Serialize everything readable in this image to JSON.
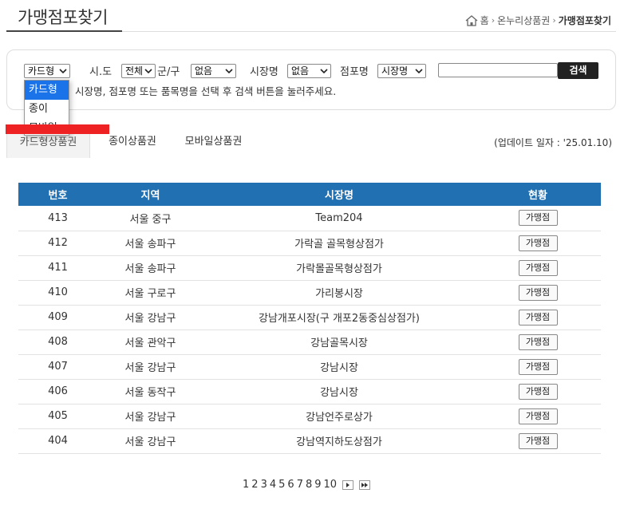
{
  "page_title": "가맹점포찾기",
  "breadcrumb": {
    "home": "홈",
    "level1": "온누리상품권",
    "current": "가맹점포찾기"
  },
  "search": {
    "card_type_selected": "카드형",
    "sido_label": "시.도",
    "sido_selected": "전체",
    "gungu_label": "군/구",
    "gungu_selected": "없음",
    "market_label": "시장명",
    "market_selected": "없음",
    "store_label": "점포명",
    "store_selected": "시장명",
    "keyword_value": "",
    "button_label": "검색",
    "hint": "시장명, 점포명 또는 품목명을 선택 후 검색 버튼을 눌러주세요."
  },
  "dropdown": {
    "options": [
      "카드형",
      "종이",
      "모바일"
    ],
    "selected_index": 0,
    "highlight_color": "#1a73e8"
  },
  "tabs": [
    {
      "label": "카드형상품권",
      "active": true
    },
    {
      "label": "종이상품권",
      "active": false
    },
    {
      "label": "모바일상품권",
      "active": false
    }
  ],
  "update_text": "(업데이트 일자 : '25.01.10)",
  "table": {
    "headers": [
      "번호",
      "지역",
      "시장명",
      "현황"
    ],
    "header_color": "#2170b2",
    "rows": [
      {
        "no": "413",
        "region": "서울 중구",
        "market": "Team204",
        "status": "가맹점"
      },
      {
        "no": "412",
        "region": "서울 송파구",
        "market": "가락골 골목형상점가",
        "status": "가맹점"
      },
      {
        "no": "411",
        "region": "서울 송파구",
        "market": "가락몰골목형상점가",
        "status": "가맹점"
      },
      {
        "no": "410",
        "region": "서울 구로구",
        "market": "가리봉시장",
        "status": "가맹점"
      },
      {
        "no": "409",
        "region": "서울 강남구",
        "market": "강남개포시장(구 개포2동중심상점가)",
        "status": "가맹점"
      },
      {
        "no": "408",
        "region": "서울 관악구",
        "market": "강남골목시장",
        "status": "가맹점"
      },
      {
        "no": "407",
        "region": "서울 강남구",
        "market": "강남시장",
        "status": "가맹점"
      },
      {
        "no": "406",
        "region": "서울 동작구",
        "market": "강남시장",
        "status": "가맹점"
      },
      {
        "no": "405",
        "region": "서울 강남구",
        "market": "강남언주로상가",
        "status": "가맹점"
      },
      {
        "no": "404",
        "region": "서울 강남구",
        "market": "강남역지하도상점가",
        "status": "가맹점"
      }
    ]
  },
  "pager": {
    "pages": [
      "1",
      "2",
      "3",
      "4",
      "5",
      "6",
      "7",
      "8",
      "9",
      "10"
    ],
    "next_icon": "next-page-icon",
    "last_icon": "last-page-icon"
  }
}
